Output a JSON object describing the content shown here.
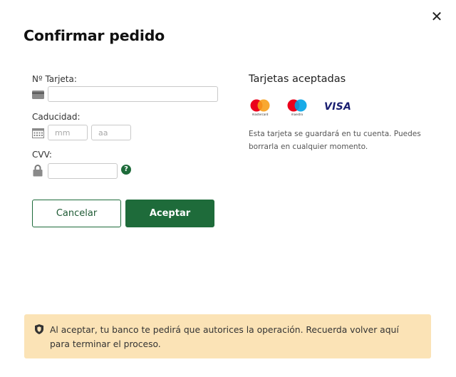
{
  "dialog": {
    "title": "Confirmar pedido",
    "close_icon": "close-icon"
  },
  "form": {
    "card_number": {
      "label": "Nº Tarjeta:",
      "icon": "credit-card-icon",
      "value": "",
      "placeholder": ""
    },
    "expiry": {
      "label": "Caducidad:",
      "icon": "calendar-icon",
      "month_placeholder": "mm",
      "year_placeholder": "aa"
    },
    "cvv": {
      "label": "CVV:",
      "icon": "lock-icon",
      "value": "",
      "help_icon": "question-circle-icon",
      "help_label": "?"
    }
  },
  "buttons": {
    "cancel_label": "Cancelar",
    "accept_label": "Aceptar"
  },
  "accepted_cards": {
    "title": "Tarjetas aceptadas",
    "cards": [
      {
        "name": "mastercard",
        "label": "mastercard"
      },
      {
        "name": "maestro",
        "label": "maestro"
      },
      {
        "name": "visa",
        "label": "VISA"
      }
    ],
    "note": "Esta tarjeta se guardará en tu cuenta. Puedes borrarla en cualquier momento."
  },
  "banner": {
    "icon": "shield-icon",
    "text": "Al aceptar, tu banco te pedirá que autorices la operación. Recuerda volver aquí para terminar el proceso."
  },
  "colors": {
    "primary_green": "#1e6b3a",
    "banner_bg": "#fbe3b6",
    "mastercard_red": "#eb001b",
    "mastercard_orange": "#f79e1b",
    "maestro_blue": "#00a2e5",
    "visa_blue": "#1a1f71"
  }
}
